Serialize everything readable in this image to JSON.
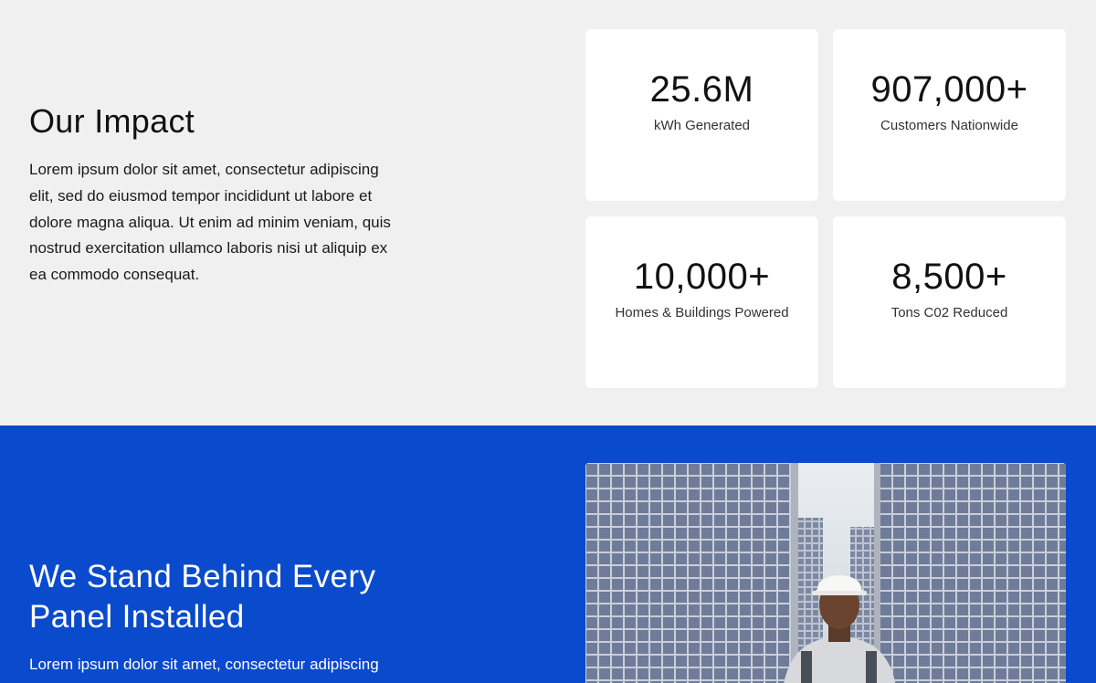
{
  "impact": {
    "title": "Our Impact",
    "body": "Lorem ipsum dolor sit amet, consectetur adipiscing elit, sed do eiusmod tempor incididunt ut labore et dolore magna aliqua. Ut enim ad minim veniam, quis nostrud exercitation ullamco laboris nisi ut aliquip ex ea commodo consequat.",
    "stats": [
      {
        "value": "25.6M",
        "label": "kWh Generated"
      },
      {
        "value": "907,000+",
        "label": "Customers Nationwide"
      },
      {
        "value": "10,000+",
        "label": "Homes & Buildings Powered"
      },
      {
        "value": "8,500+",
        "label": "Tons C02 Reduced"
      }
    ]
  },
  "guarantee": {
    "title": "We Stand Behind Every Panel Installed",
    "body": "Lorem ipsum dolor sit amet, consectetur adipiscing"
  },
  "colors": {
    "page_background": "#f0f0f0",
    "card_background": "#ffffff",
    "accent_blue": "#0a4acc"
  }
}
